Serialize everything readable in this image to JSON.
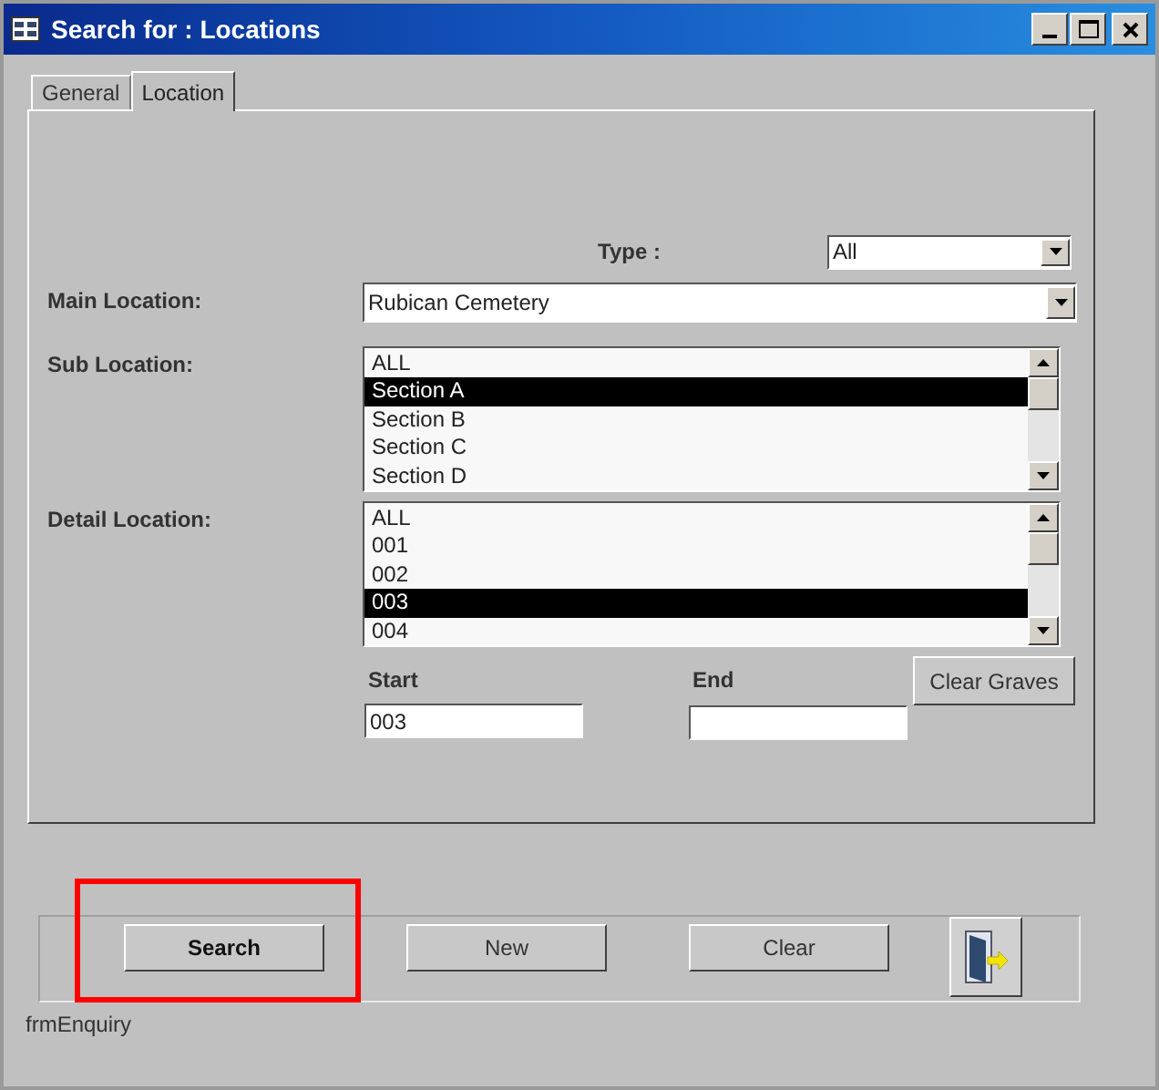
{
  "window": {
    "title": "Search for : Locations"
  },
  "tabs": [
    {
      "label": "General",
      "selected": false
    },
    {
      "label": "Location",
      "selected": true
    }
  ],
  "type": {
    "label": "Type :",
    "value": "All"
  },
  "main_location": {
    "label": "Main Location:",
    "value": "Rubican Cemetery"
  },
  "sub_location": {
    "label": "Sub Location:",
    "items": [
      {
        "text": "ALL",
        "selected": false
      },
      {
        "text": "Section A",
        "selected": true
      },
      {
        "text": "Section B",
        "selected": false
      },
      {
        "text": "Section C",
        "selected": false
      },
      {
        "text": "Section D",
        "selected": false
      }
    ]
  },
  "detail_location": {
    "label": "Detail Location:",
    "items": [
      {
        "text": "ALL",
        "selected": false
      },
      {
        "text": "001",
        "selected": false
      },
      {
        "text": "002",
        "selected": false
      },
      {
        "text": "003",
        "selected": true
      },
      {
        "text": "004",
        "selected": false
      }
    ]
  },
  "start": {
    "label": "Start",
    "value": "003"
  },
  "end": {
    "label": "End"
  },
  "clear_graves_button": "Clear Graves",
  "buttons": [
    {
      "label": "Search",
      "bold": true,
      "highlighted": true
    },
    {
      "label": "New",
      "bold": false,
      "highlighted": false
    },
    {
      "label": "Clear",
      "bold": false,
      "highlighted": false
    }
  ],
  "form_name": "frmEnquiry"
}
